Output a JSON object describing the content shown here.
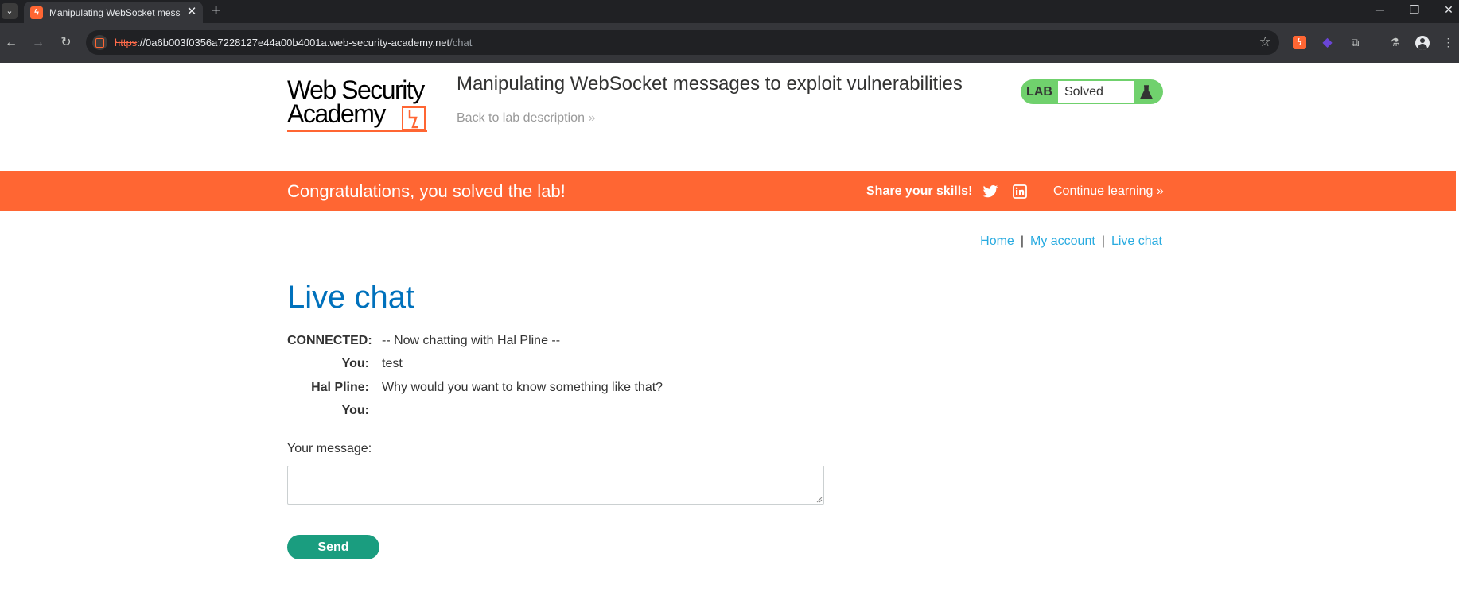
{
  "browser": {
    "tab_title": "Manipulating WebSocket messages to exploit vulnerabilities",
    "tab_close": "✕",
    "new_tab": "+",
    "url_scheme": "https",
    "url_host": "://0a6b003f0356a7228127e44a00b4001a.web-security-academy.net",
    "url_path": "/chat",
    "icons": {
      "back": "arrow-left-icon",
      "forward": "arrow-right-icon",
      "reload": "reload-icon",
      "bookmark": "star-icon",
      "extensions": "puzzle-icon",
      "labs": "flask-icon",
      "profile": "profile-icon",
      "menu": "kebab-menu-icon"
    }
  },
  "header": {
    "logo_line1": "Web Security",
    "logo_line2": "Academy",
    "lab_title": "Manipulating WebSocket messages to exploit vulnerabilities",
    "back_link": "Back to lab description",
    "lab_badge": "LAB",
    "lab_status": "Solved"
  },
  "banner": {
    "message": "Congratulations, you solved the lab!",
    "share": "Share your skills!",
    "continue": "Continue learning"
  },
  "nav": {
    "home": "Home",
    "separator": "|",
    "account": "My account",
    "chat": "Live chat"
  },
  "page_title": "Live chat",
  "chat": {
    "rows": [
      {
        "who": "CONNECTED:",
        "what": "-- Now chatting with Hal Pline --"
      },
      {
        "who": "You:",
        "what": "test"
      },
      {
        "who": "Hal Pline:",
        "what": "Why would you want to know something like that?"
      },
      {
        "who": "You:",
        "what": ""
      }
    ]
  },
  "form": {
    "label": "Your message:",
    "value": "",
    "send": "Send"
  },
  "colors": {
    "brand_orange": "#ff6633",
    "lab_green": "#70d16d",
    "title_blue": "#0071bc",
    "link_blue": "#29abe0",
    "send_green": "#1a9d7f"
  }
}
